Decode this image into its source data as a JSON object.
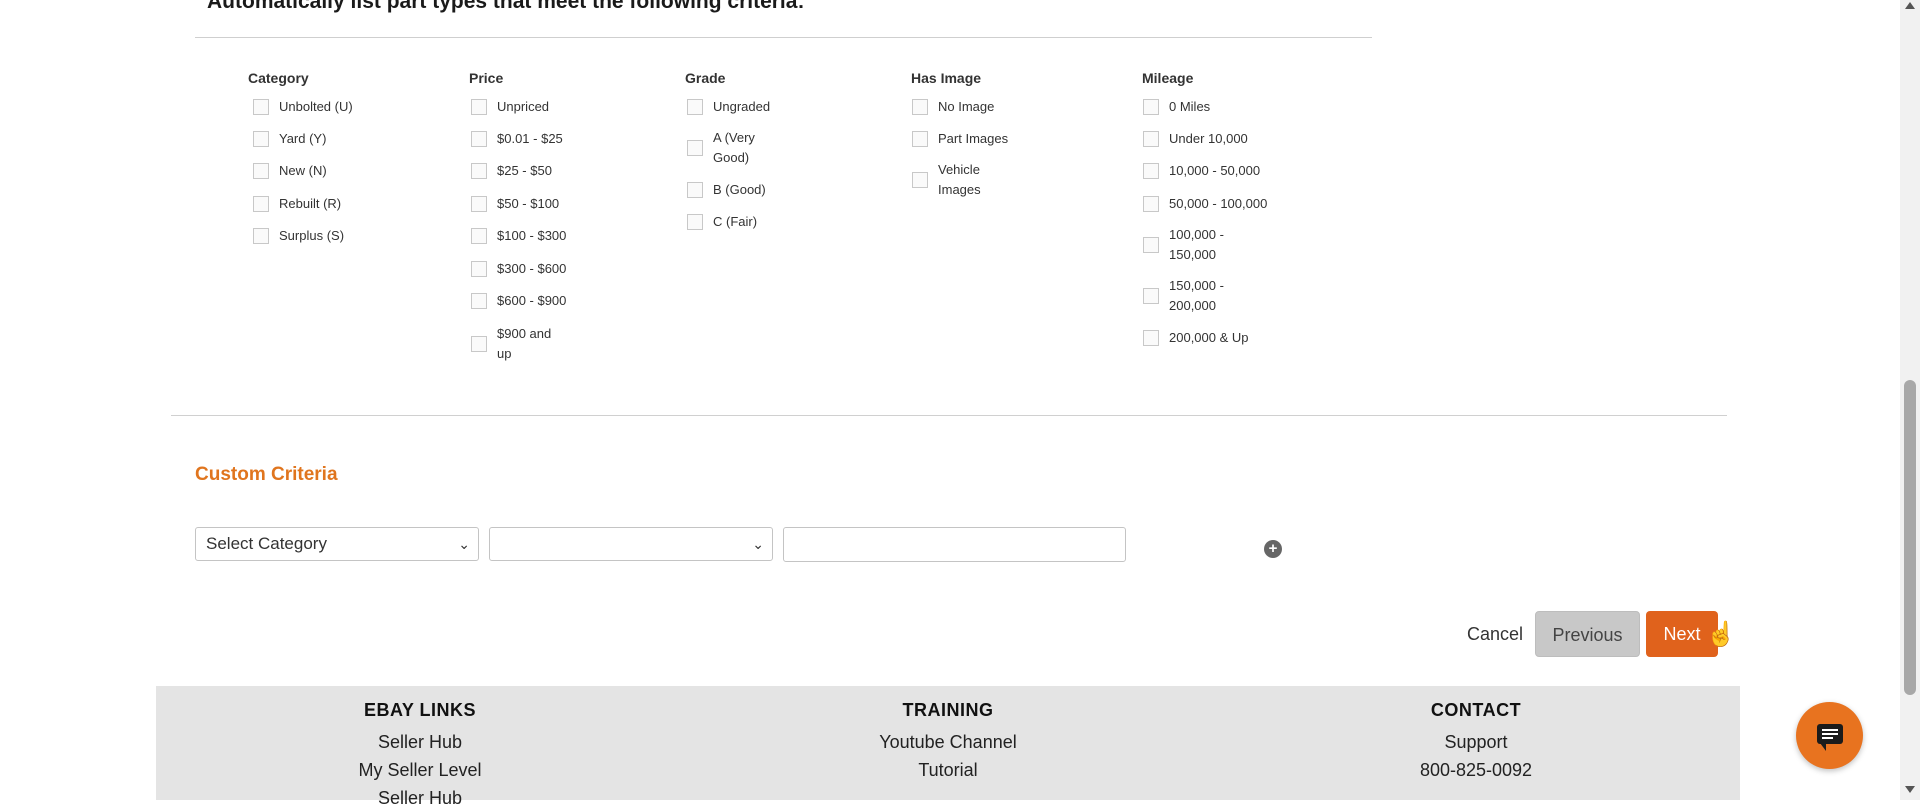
{
  "criteria": {
    "heading": "Automatically list part types that meet the following criteria:",
    "columns": [
      {
        "title": "Category",
        "options": [
          "Unbolted (U)",
          "Yard (Y)",
          "New (N)",
          "Rebuilt (R)",
          "Surplus (S)"
        ]
      },
      {
        "title": "Price",
        "options": [
          "Unpriced",
          "$0.01 - $25",
          "$25 - $50",
          "$50 - $100",
          "$100 - $300",
          "$300 - $600",
          "$600 - $900",
          "$900 and up"
        ]
      },
      {
        "title": "Grade",
        "options": [
          "Ungraded",
          "A (Very Good)",
          "B (Good)",
          "C (Fair)"
        ]
      },
      {
        "title": "Has Image",
        "options": [
          "No Image",
          "Part Images",
          "Vehicle Images"
        ]
      },
      {
        "title": "Mileage",
        "options": [
          "0 Miles",
          "Under 10,000",
          "10,000 - 50,000",
          "50,000 - 100,000",
          "100,000 - 150,000",
          "150,000 - 200,000",
          "200,000 & Up"
        ]
      }
    ]
  },
  "custom": {
    "title": "Custom Criteria",
    "category_select": "Select Category",
    "operator_select": "",
    "value_input": ""
  },
  "actions": {
    "cancel": "Cancel",
    "previous": "Previous",
    "next": "Next"
  },
  "footer": {
    "columns": [
      {
        "title": "EBAY LINKS",
        "links": [
          "Seller Hub",
          "My Seller Level",
          "Seller Hub"
        ]
      },
      {
        "title": "TRAINING",
        "links": [
          "Youtube Channel",
          "Tutorial"
        ]
      },
      {
        "title": "CONTACT",
        "links": [
          "Support",
          "800-825-0092"
        ]
      }
    ]
  },
  "colors": {
    "accent": "#e0751e",
    "next_button": "#e0621c",
    "chat_button": "#e8731f",
    "footer_bg": "#e4e4e4"
  },
  "icons": [
    "plus-icon",
    "chat-icon",
    "pointer-cursor-icon"
  ]
}
